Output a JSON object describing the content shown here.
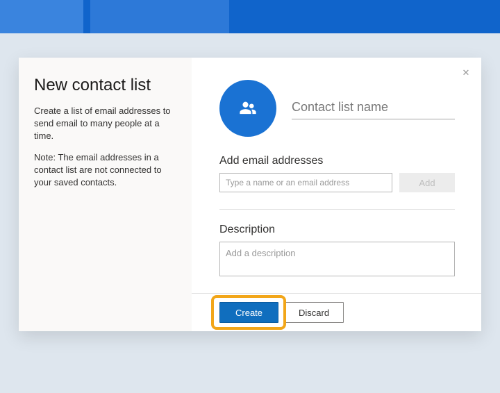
{
  "left": {
    "title": "New contact list",
    "desc": "Create a list of email addresses to send email to many people at a time.",
    "note": "Note: The email addresses in a contact list are not connected to your saved contacts."
  },
  "form": {
    "name_placeholder": "Contact list name",
    "email_section_label": "Add email addresses",
    "email_placeholder": "Type a name or an email address",
    "add_label": "Add",
    "desc_section_label": "Description",
    "desc_placeholder": "Add a description"
  },
  "footer": {
    "create": "Create",
    "discard": "Discard"
  },
  "close": "✕"
}
